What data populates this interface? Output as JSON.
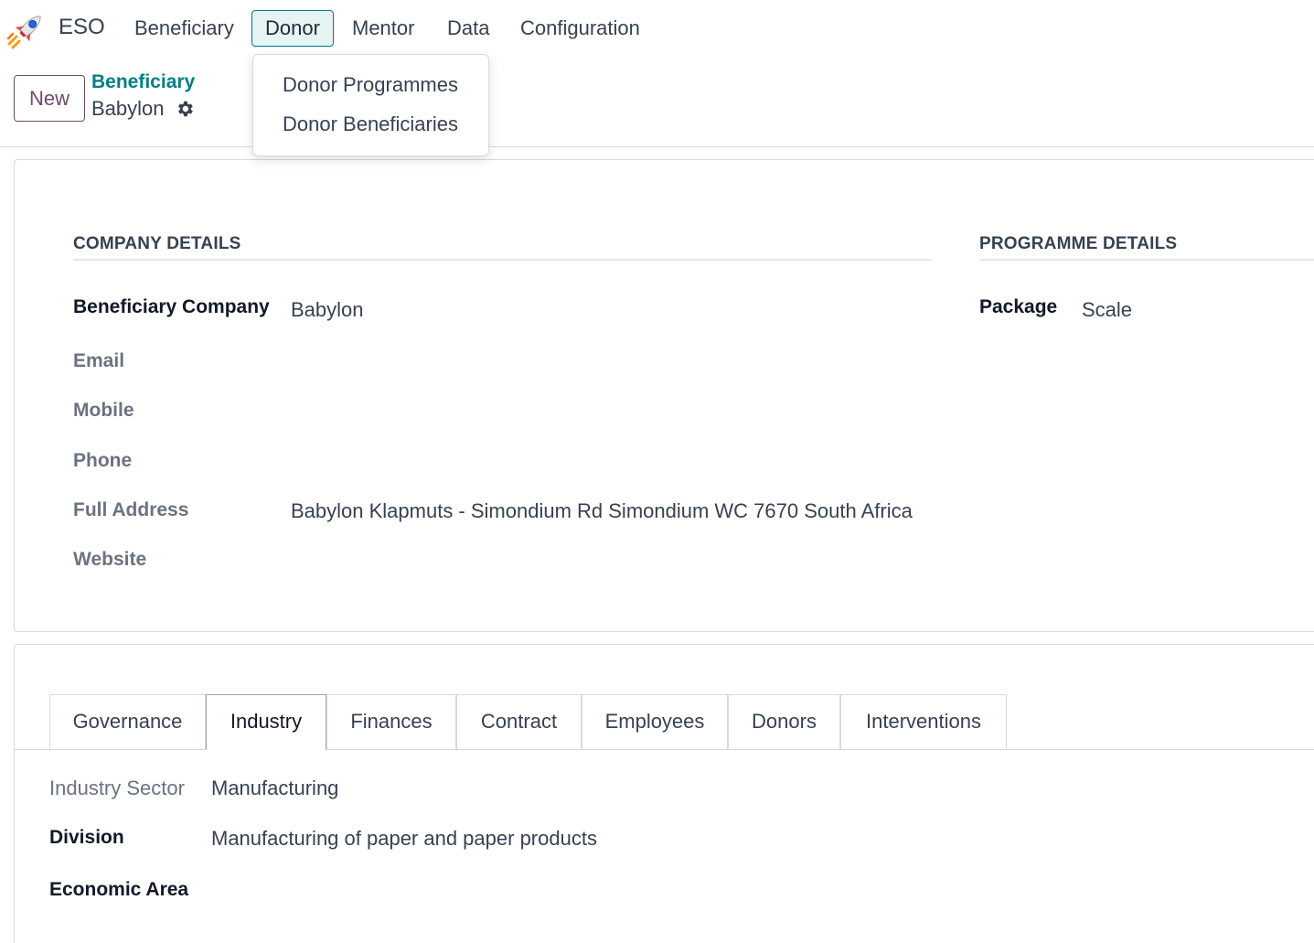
{
  "navbar": {
    "app_name": "ESO",
    "menu": [
      {
        "label": "Beneficiary"
      },
      {
        "label": "Donor"
      },
      {
        "label": "Mentor"
      },
      {
        "label": "Data"
      },
      {
        "label": "Configuration"
      }
    ],
    "donor_dropdown": [
      "Donor Programmes",
      "Donor Beneficiaries"
    ]
  },
  "control_panel": {
    "new_label": "New",
    "breadcrumb_parent": "Beneficiary",
    "breadcrumb_current": "Babylon"
  },
  "company_details": {
    "title": "COMPANY DETAILS",
    "fields": [
      {
        "label": "Beneficiary Company",
        "value": "Babylon"
      },
      {
        "label": "Email",
        "value": ""
      },
      {
        "label": "Mobile",
        "value": ""
      },
      {
        "label": "Phone",
        "value": ""
      },
      {
        "label": "Full Address",
        "value": "Babylon Klapmuts - Simondium Rd Simondium WC 7670 South Africa"
      },
      {
        "label": "Website",
        "value": ""
      }
    ]
  },
  "programme_details": {
    "title": "PROGRAMME DETAILS",
    "fields": [
      {
        "label": "Package",
        "value": "Scale"
      }
    ]
  },
  "tabs": [
    "Governance",
    "Industry",
    "Finances",
    "Contract",
    "Employees",
    "Donors",
    "Interventions"
  ],
  "active_tab": "Industry",
  "industry": {
    "fields": [
      {
        "label": "Industry Sector",
        "value": "Manufacturing"
      },
      {
        "label": "Division",
        "value": "Manufacturing of paper and paper products"
      },
      {
        "label": "Economic Area",
        "value": ""
      }
    ]
  },
  "colors": {
    "accent": "#017e84",
    "primary": "#714b67",
    "border": "#d8dadd"
  }
}
